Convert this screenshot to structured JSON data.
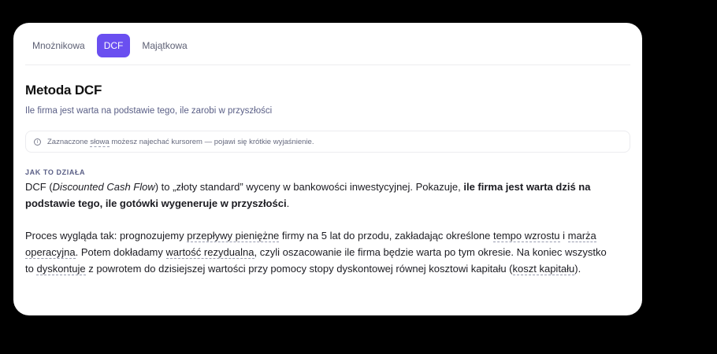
{
  "tabs": [
    {
      "label": "Mnożnikowa",
      "active": false
    },
    {
      "label": "DCF",
      "active": true
    },
    {
      "label": "Majątkowa",
      "active": false
    }
  ],
  "heading": {
    "title": "Metoda DCF",
    "subtitle": "Ile firma jest warta na podstawie tego, ile zarobi w przyszłości"
  },
  "hint": {
    "icon": "info-icon",
    "before": "Zaznaczone ",
    "term": "słowa",
    "after": " możesz najechać kursorem — pojawi się krótkie wyjaśnienie."
  },
  "section": {
    "label": "JAK TO DZIAŁA"
  },
  "paragraph1": {
    "p1": "DCF (",
    "italic": "Discounted Cash Flow",
    "p2": ") to „złoty standard” wyceny w bankowości inwestycyjnej. Pokazuje, ",
    "bold": "ile firma jest warta dziś na podstawie tego, ile gotówki wygeneruje w przyszłości",
    "p3": "."
  },
  "paragraph2": {
    "t1": "Proces wygląda tak: prognozujemy ",
    "term1": "przepływy pieniężne",
    "t2": " firmy na 5 lat do przodu, zakładając określone ",
    "term2": "tempo wzrostu",
    "t3": " i ",
    "term3": "marża operacyjna",
    "t4": ". Potem dokładamy ",
    "term4": "wartość rezydualna",
    "t5": ", czyli oszacowanie ile firma będzie warta po tym okresie. Na koniec wszystko to ",
    "term5": "dyskontuje",
    "t6": " z powrotem do dzisiejszej wartości przy pomocy stopy dyskontowej równej kosztowi kapitału (",
    "term6": "koszt kapitału",
    "t7": ")."
  }
}
